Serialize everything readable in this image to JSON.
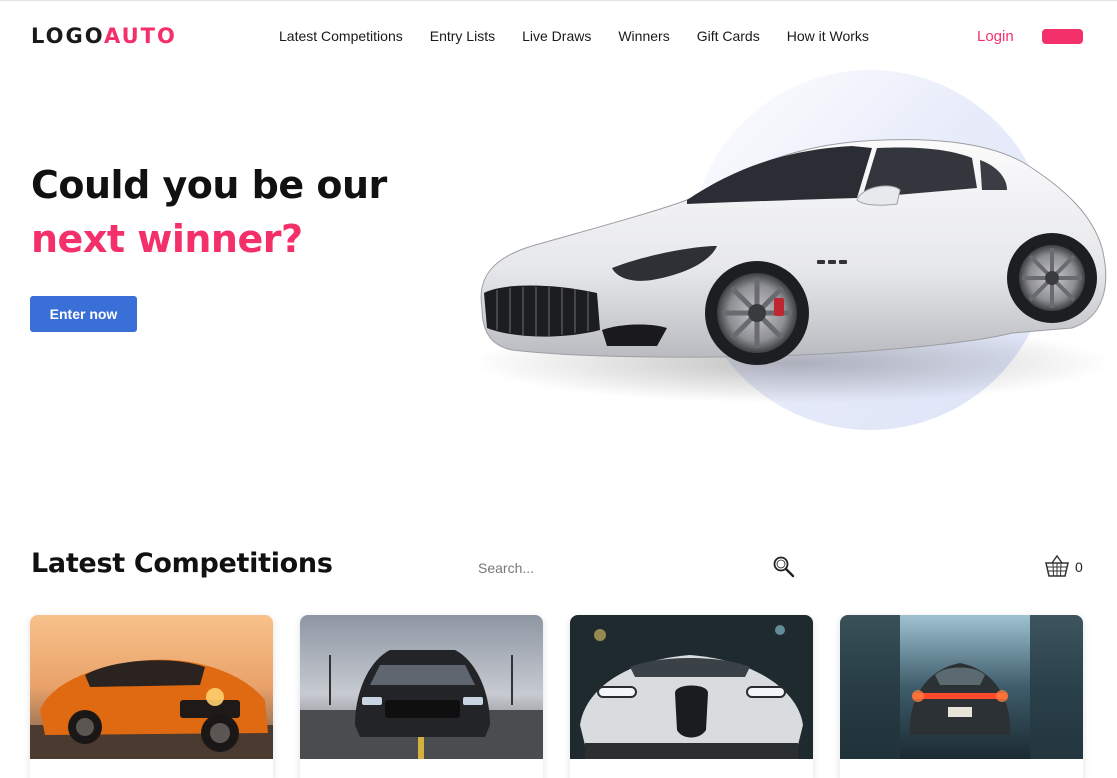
{
  "header": {
    "logo_part1": "LOGO",
    "logo_part2": "AUTO",
    "nav": [
      "Latest Competitions",
      "Entry Lists",
      "Live Draws",
      "Winners",
      "Gift Cards",
      "How it Works"
    ],
    "login_label": "Login"
  },
  "hero": {
    "title_line1": "Could you be our",
    "title_line2": "next winner?",
    "cta_label": "Enter now"
  },
  "competitions": {
    "title": "Latest Competitions",
    "search_placeholder": "Search...",
    "basket_count": "0",
    "cards": [
      {
        "name": "competition-card-orange-sedan",
        "icon": "orange-sedan-image"
      },
      {
        "name": "competition-card-mustang",
        "icon": "black-muscle-car-image"
      },
      {
        "name": "competition-card-bugatti",
        "icon": "silver-hypercar-image"
      },
      {
        "name": "competition-card-porsche",
        "icon": "sports-car-rear-image"
      }
    ]
  },
  "colors": {
    "accent": "#f3306a",
    "primary_button": "#3a6fd8",
    "text": "#111111",
    "hero_circle": "#dde3f7"
  }
}
